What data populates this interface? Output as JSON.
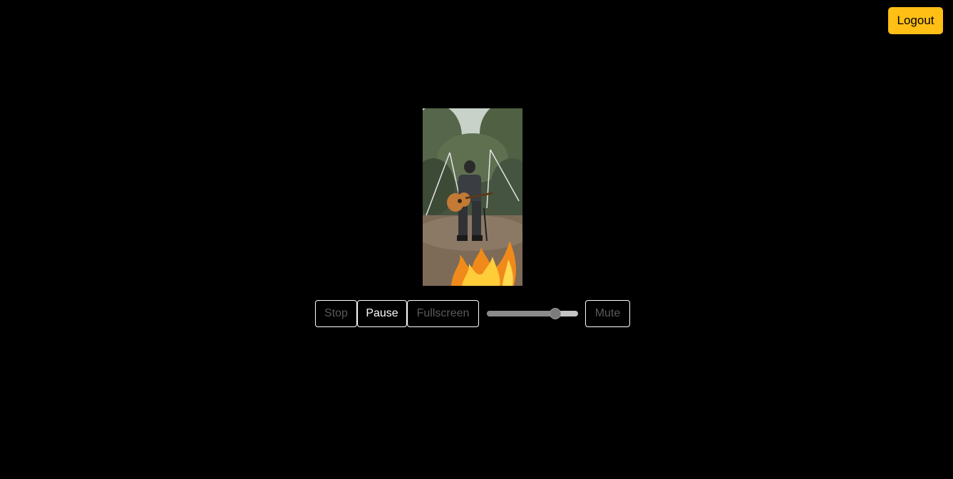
{
  "header": {
    "logout_label": "Logout"
  },
  "colors": {
    "accent": "#ffbf14",
    "background": "#000000"
  },
  "player": {
    "stop_label": "Stop",
    "pause_label": "Pause",
    "fullscreen_label": "Fullscreen",
    "mute_label": "Mute",
    "volume_level": 0.75,
    "video_content": "person playing acoustic guitar outdoors beside a campfire"
  }
}
